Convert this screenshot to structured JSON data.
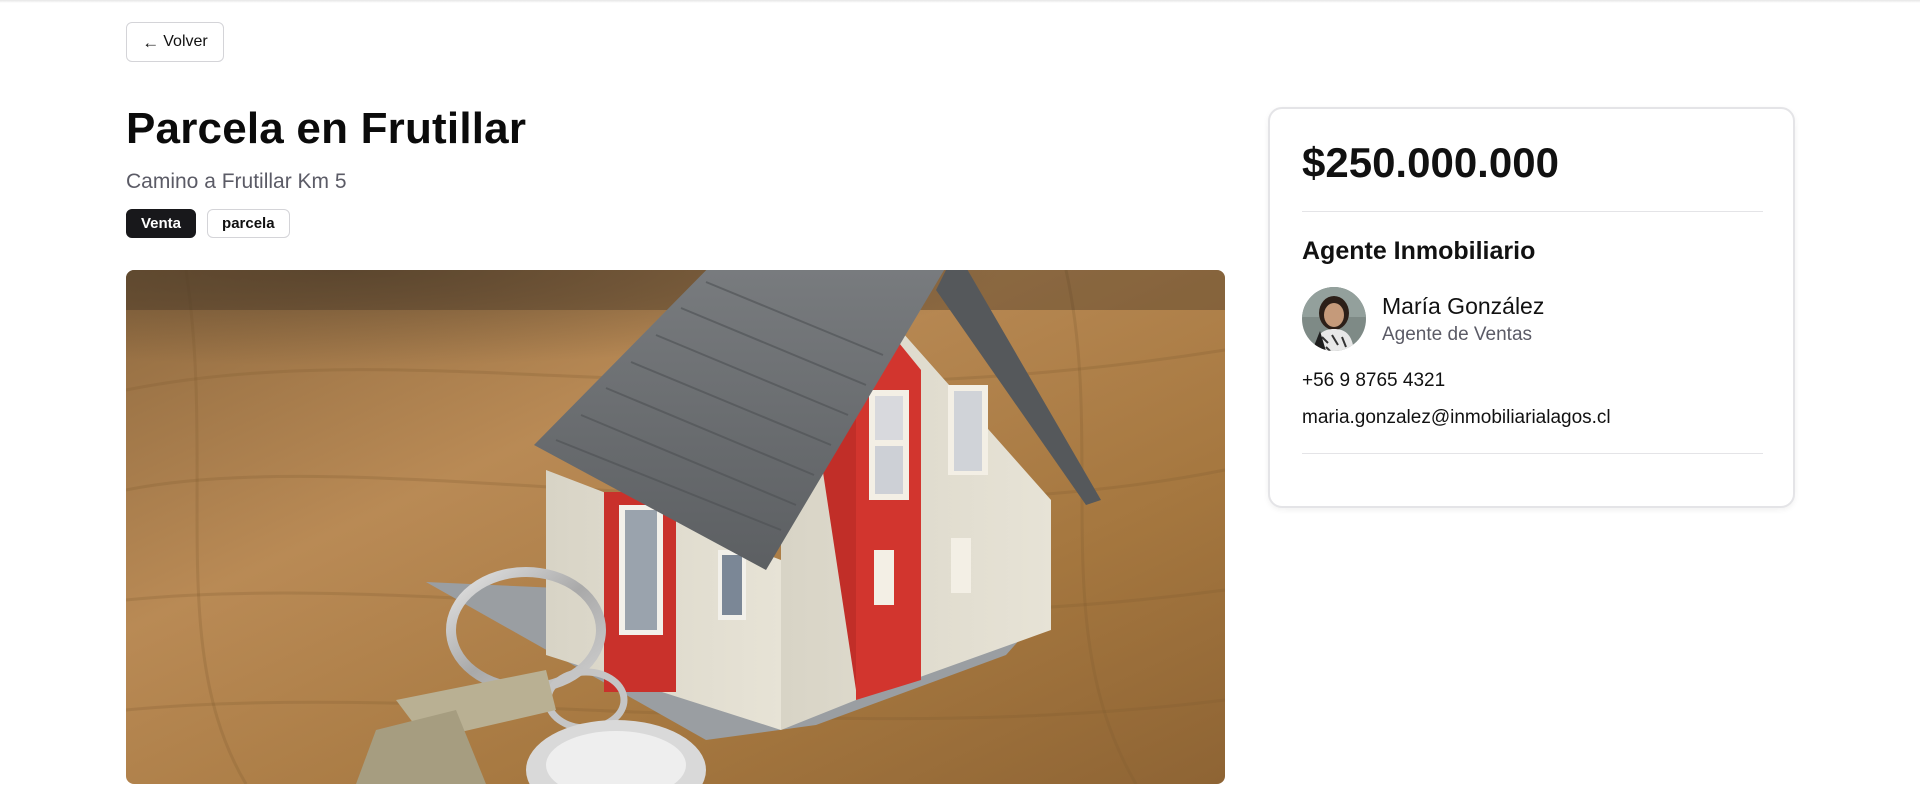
{
  "nav": {
    "back_label": "Volver",
    "back_icon": "arrow-left-icon"
  },
  "listing": {
    "title": "Parcela en Frutillar",
    "address": "Camino a Frutillar Km 5",
    "tags": [
      "Venta",
      "parcela"
    ],
    "image_alt": "Miniature house model with keys on a wooden table"
  },
  "sidebar": {
    "price": "$250.000.000",
    "agent_heading": "Agente Inmobiliario",
    "agent": {
      "name": "María González",
      "role": "Agente de Ventas",
      "phone": "+56 9 8765 4321",
      "email": "maria.gonzalez@inmobiliarialagos.cl"
    }
  },
  "colors": {
    "primary_tag": "#18181b",
    "muted_text": "#5b5b66",
    "border": "#e4e4e7"
  }
}
